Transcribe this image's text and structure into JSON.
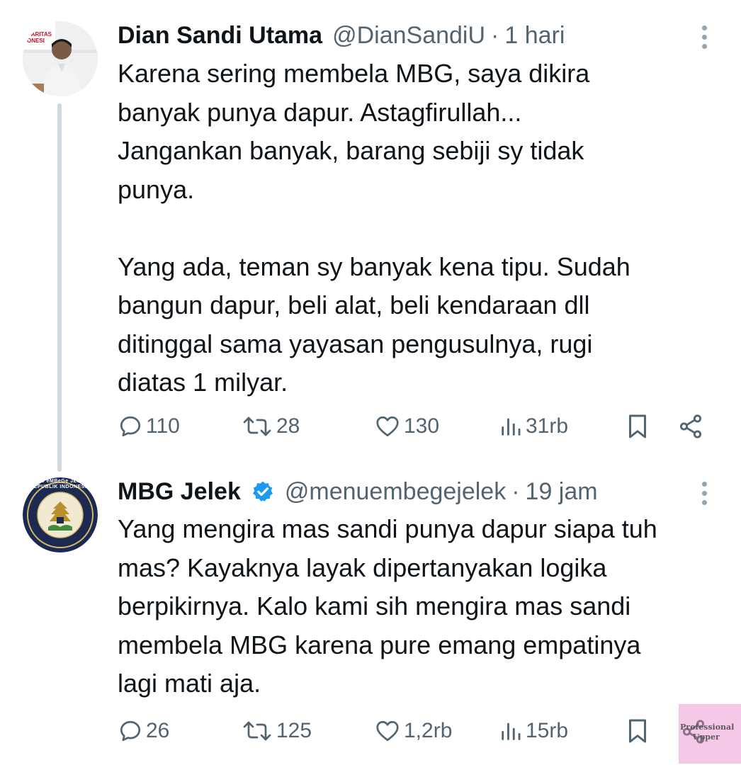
{
  "tweets": [
    {
      "author": "Dian Sandi Utama",
      "handle": "@DianSandiU",
      "separator": "·",
      "time": "1 hari",
      "avatar_badge_text": "DARITAS ONESI",
      "lines": [
        "Karena sering membela MBG, saya dikira",
        "banyak punya dapur. Astagfirullah...",
        "Jangankan banyak, barang sebiji sy tidak",
        "punya.",
        "",
        "Yang ada, teman sy banyak kena tipu. Sudah",
        "bangun dapur, beli alat, beli kendaraan dll",
        "ditinggal sama yayasan pengusulnya, rugi",
        "diatas 1 milyar."
      ],
      "stats": {
        "replies": "110",
        "retweets": "28",
        "likes": "130",
        "views": "31rb"
      }
    },
    {
      "author": "MBG Jelek",
      "handle": "@menuembegejelek",
      "separator": "·",
      "time": "19 jam",
      "verified": true,
      "avatar_text": "MENU eMBeGe JELEK · REPUBLIK INDONESIA",
      "lines": [
        "Yang mengira mas sandi punya dapur siapa tuh",
        "mas? Kayaknya layak dipertanyakan logika",
        "berpikirnya. Kalo kami sih mengira mas sandi",
        "membela MBG karena pure emang empatinya",
        "lagi mati aja."
      ],
      "stats": {
        "replies": "26",
        "retweets": "125",
        "likes": "1,2rb",
        "views": "15rb"
      }
    }
  ],
  "watermark": {
    "line1": "Professional",
    "line2": "Upper"
  },
  "icons": [
    "reply-icon",
    "retweet-icon",
    "like-icon",
    "views-icon",
    "bookmark-icon",
    "share-icon",
    "more-icon",
    "verified-icon"
  ],
  "colors": {
    "text": "#0f1419",
    "muted": "#536471",
    "verified": "#1d9bf0",
    "thread": "#cfd9de",
    "watermark_bg": "#f6c8e8"
  }
}
